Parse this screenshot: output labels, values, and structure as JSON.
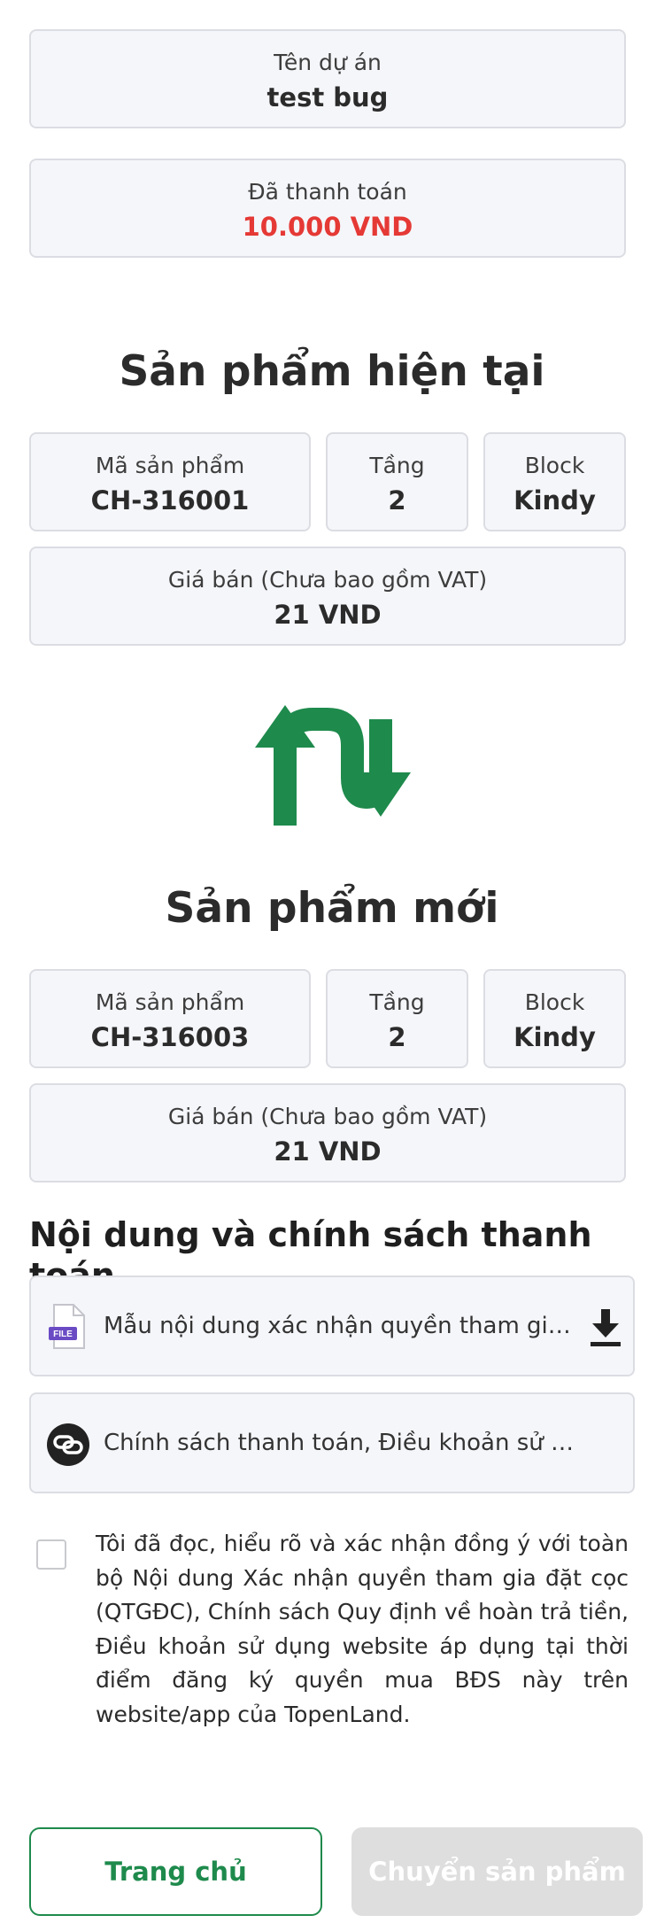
{
  "project": {
    "label": "Tên dự án",
    "value": "test bug"
  },
  "payment": {
    "label": "Đã thanh toán",
    "value": "10.000 VND"
  },
  "current_product": {
    "title": "Sản phẩm hiện tại",
    "code_label": "Mã sản phẩm",
    "code": "CH-316001",
    "floor_label": "Tầng",
    "floor": "2",
    "block_label": "Block",
    "block": "Kindy",
    "price_label": "Giá bán (Chưa bao gồm VAT)",
    "price": "21 VND"
  },
  "new_product": {
    "title": "Sản phẩm mới",
    "code_label": "Mã sản phẩm",
    "code": "CH-316003",
    "floor_label": "Tầng",
    "floor": "2",
    "block_label": "Block",
    "block": "Kindy",
    "price_label": "Giá bán (Chưa bao gồm VAT)",
    "price": "21 VND"
  },
  "policy": {
    "title": "Nội dung và chính sách thanh toán",
    "document_name": "Mẫu nội dung xác nhận quyền tham gia đặt cọc",
    "document_badge": "FILE",
    "link_text": "Chính sách thanh toán, Điều khoản sử dụng website"
  },
  "agreement": {
    "text": "Tôi đã đọc, hiểu rõ và xác nhận đồng ý với toàn bộ Nội dung Xác nhận quyền tham gia đặt cọc (QTGĐC), Chính sách Quy định về hoàn trả tiền, Điều khoản sử dụng website áp dụng tại thời điểm đăng ký quyền mua BĐS này trên website/app của TopenLand."
  },
  "buttons": {
    "home": "Trang chủ",
    "transfer": "Chuyển sản phẩm"
  },
  "colors": {
    "accent": "#1e8a4c",
    "paid_amount": "#e53935",
    "disabled": "#dedede",
    "file_badge": "#6a4bc4"
  },
  "icons": {
    "swap": "swap-arrows-icon",
    "file": "file-icon",
    "download": "download-icon",
    "link": "link-icon"
  }
}
